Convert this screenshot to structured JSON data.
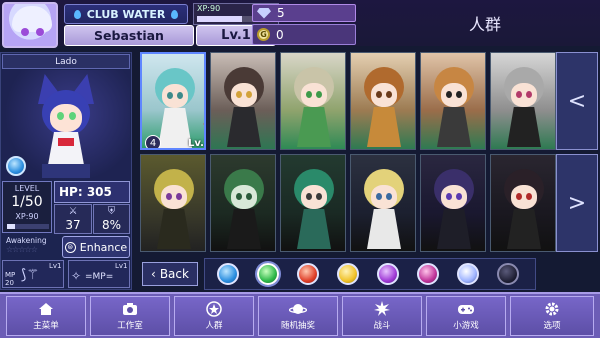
{
  "header": {
    "club_label": "CLUB WATER",
    "player_name": "Sebastian",
    "xp_label": "XP:90",
    "xp_progress": 0.75,
    "level_label": "Lv.1",
    "gems": "5",
    "gold": "0",
    "gold_icon": "G",
    "screen_title": "人群"
  },
  "character": {
    "name": "Lado",
    "level_heading": "LEVEL",
    "level_value": "1/50",
    "xp": "XP:90",
    "hp": "HP: 305",
    "attack": "37",
    "defense": "8%",
    "awakening_label": "Awakening",
    "awakening_stars": "☆☆☆☆☆",
    "enhance_label": "Enhance",
    "skill1_mp": "MP",
    "skill1_mp_value": "20",
    "skill1_lv": "Lv1",
    "skill2_lv": "Lv1",
    "skill2_label": "=MP="
  },
  "grid": {
    "selected_slot_badge": "4",
    "selected_level": "Lv.1"
  },
  "controls": {
    "back_label": "Back",
    "prev_arrow": "<",
    "next_arrow": ">"
  },
  "nav": {
    "items": [
      {
        "label": "主菜单",
        "icon": "home-icon"
      },
      {
        "label": "工作室",
        "icon": "camera-icon"
      },
      {
        "label": "人群",
        "icon": "star-icon"
      },
      {
        "label": "随机抽奖",
        "icon": "planet-icon"
      },
      {
        "label": "战斗",
        "icon": "burst-icon"
      },
      {
        "label": "小游戏",
        "icon": "gamepad-icon"
      },
      {
        "label": "选项",
        "icon": "gear-icon"
      }
    ]
  },
  "colors": {
    "accent": "#6c5db6",
    "background": "#141a33",
    "panel": "#1c2450",
    "filter_water": "#2c8fe0",
    "filter_wind": "#2eb84a",
    "filter_fire": "#e0402a",
    "filter_light": "#f0c22a",
    "filter_dark": "#a03bd6",
    "filter_void": "#c0349a",
    "filter_special": "#9fb4ff",
    "filter_shadow": "#1a1a2e"
  }
}
